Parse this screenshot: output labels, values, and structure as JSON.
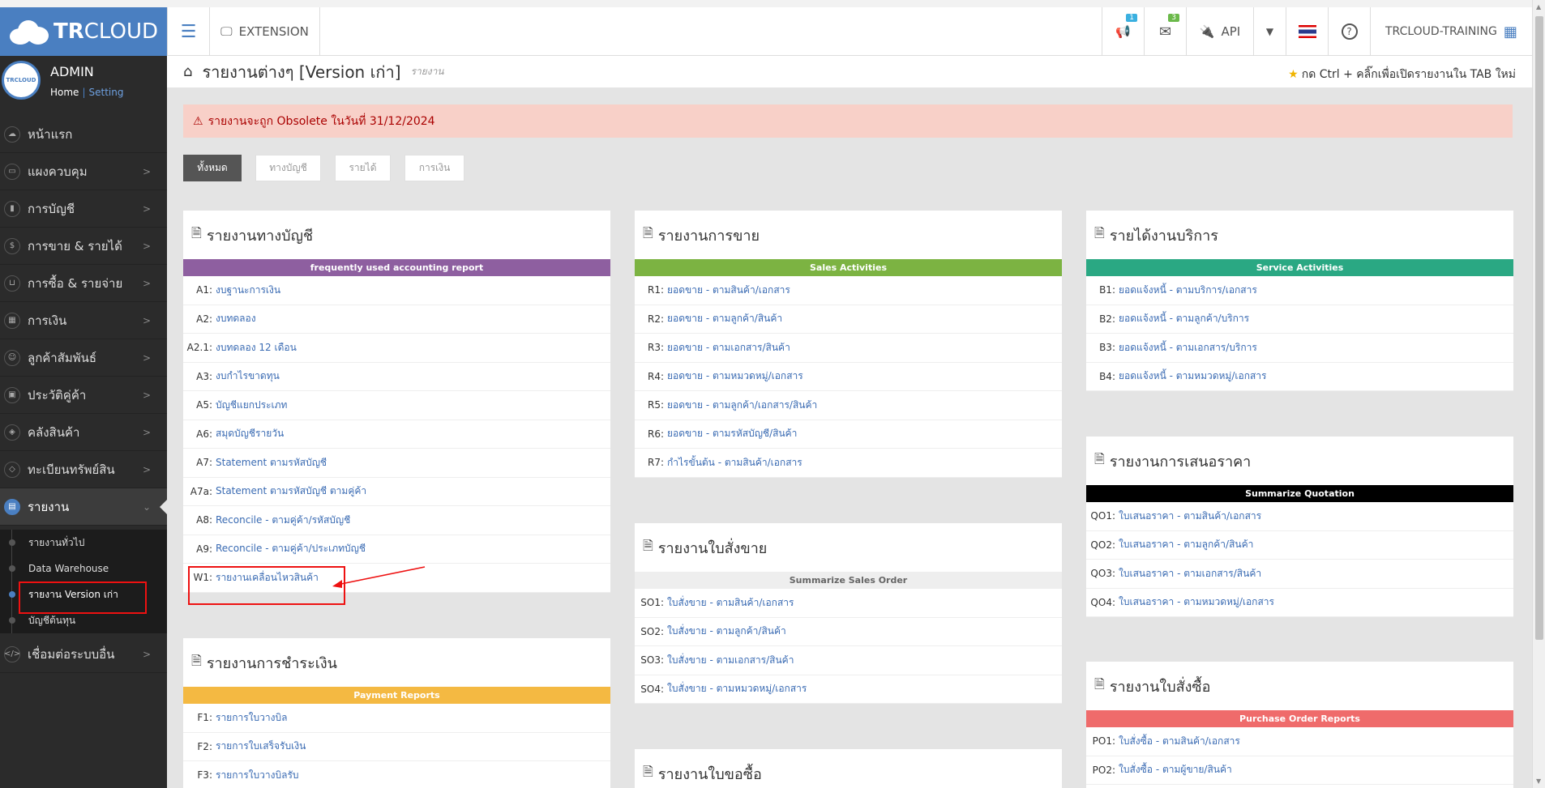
{
  "topbar": {
    "brand_bold": "TR",
    "brand_light": "CLOUD",
    "extension_label": "EXTENSION",
    "notif_count": "1",
    "mail_count": "3",
    "api_label": "API",
    "company": "TRCLOUD-TRAINING"
  },
  "user": {
    "name": "ADMIN",
    "home": "Home",
    "sep": "|",
    "setting": "Setting",
    "avatar_text": "TRCLOUD"
  },
  "sidebar": {
    "items": [
      {
        "label": "หน้าแรก",
        "icon": "cloud-icon"
      },
      {
        "label": "แผงควบคุม",
        "icon": "monitor-icon"
      },
      {
        "label": "การบัญชี",
        "icon": "book-icon"
      },
      {
        "label": "การขาย & รายได้",
        "icon": "dollar-icon"
      },
      {
        "label": "การซื้อ & รายจ่าย",
        "icon": "cart-icon"
      },
      {
        "label": "การเงิน",
        "icon": "calendar-icon"
      },
      {
        "label": "ลูกค้าสัมพันธ์",
        "icon": "users-icon"
      },
      {
        "label": "ประวัติคู่ค้า",
        "icon": "contact-icon"
      },
      {
        "label": "คลังสินค้า",
        "icon": "cubes-icon"
      },
      {
        "label": "ทะเบียนทรัพย์สิน",
        "icon": "diamond-icon"
      },
      {
        "label": "รายงาน",
        "icon": "report-icon"
      }
    ],
    "subs": [
      "รายงานทั่วไป",
      "Data Warehouse",
      "รายงาน Version เก่า",
      "บัญชีต้นทุน"
    ],
    "last": {
      "label": "เชื่อมต่อระบบอื่น",
      "icon": "code-icon"
    }
  },
  "breadcrumb": {
    "title": "รายงานต่างๆ [Version เก่า]",
    "subtitle": "รายงาน",
    "hint": "กด Ctrl + คลิ๊กเพื่อเปิดรายงานใน TAB ใหม่"
  },
  "alert": "รายงานจะถูก Obsolete ในวันที่ 31/12/2024",
  "filters": [
    "ทั้งหมด",
    "ทางบัญชี",
    "รายได้",
    "การเงิน"
  ],
  "panels": {
    "acc": {
      "title": "รายงานทางบัญชี",
      "band": "frequently used accounting report",
      "band_color": "#8e5fa0",
      "rows": [
        {
          "code": "A1:",
          "label": "งบฐานะการเงิน"
        },
        {
          "code": "A2:",
          "label": "งบทดลอง"
        },
        {
          "code": "A2.1:",
          "label": "งบทดลอง 12 เดือน"
        },
        {
          "code": "A3:",
          "label": "งบกำไรขาดทุน"
        },
        {
          "code": "A5:",
          "label": "บัญชีแยกประเภท"
        },
        {
          "code": "A6:",
          "label": "สมุดบัญชีรายวัน"
        },
        {
          "code": "A7:",
          "label": "Statement ตามรหัสบัญชี"
        },
        {
          "code": "A7a:",
          "label": "Statement ตามรหัสบัญชี ตามคู่ค้า"
        },
        {
          "code": "A8:",
          "label": "Reconcile - ตามคู่ค้า/รหัสบัญชี"
        },
        {
          "code": "A9:",
          "label": "Reconcile - ตามคู่ค้า/ประเภทบัญชี"
        },
        {
          "code": "W1:",
          "label": "รายงานเคลื่อนไหวสินค้า"
        }
      ]
    },
    "sales": {
      "title": "รายงานการขาย",
      "band": "Sales Activities",
      "band_color": "#7cb342",
      "rows": [
        {
          "code": "R1:",
          "label": "ยอดขาย - ตามสินค้า/เอกสาร"
        },
        {
          "code": "R2:",
          "label": "ยอดขาย - ตามลูกค้า/สินค้า"
        },
        {
          "code": "R3:",
          "label": "ยอดขาย - ตามเอกสาร/สินค้า"
        },
        {
          "code": "R4:",
          "label": "ยอดขาย - ตามหมวดหมู่/เอกสาร"
        },
        {
          "code": "R5:",
          "label": "ยอดขาย - ตามลูกค้า/เอกสาร/สินค้า"
        },
        {
          "code": "R6:",
          "label": "ยอดขาย - ตามรหัสบัญชี/สินค้า"
        },
        {
          "code": "R7:",
          "label": "กำไรขั้นต้น - ตามสินค้า/เอกสาร"
        }
      ]
    },
    "service": {
      "title": "รายได้งานบริการ",
      "band": "Service Activities",
      "band_color": "#2aa883",
      "rows": [
        {
          "code": "B1:",
          "label": "ยอดแจ้งหนี้ - ตามบริการ/เอกสาร"
        },
        {
          "code": "B2:",
          "label": "ยอดแจ้งหนี้ - ตามลูกค้า/บริการ"
        },
        {
          "code": "B3:",
          "label": "ยอดแจ้งหนี้ - ตามเอกสาร/บริการ"
        },
        {
          "code": "B4:",
          "label": "ยอดแจ้งหนี้ - ตามหมวดหมู่/เอกสาร"
        }
      ]
    },
    "quote": {
      "title": "รายงานการเสนอราคา",
      "band": "Summarize Quotation",
      "band_color": "#000000",
      "rows": [
        {
          "code": "QO1:",
          "label": "ใบเสนอราคา - ตามสินค้า/เอกสาร"
        },
        {
          "code": "QO2:",
          "label": "ใบเสนอราคา - ตามลูกค้า/สินค้า"
        },
        {
          "code": "QO3:",
          "label": "ใบเสนอราคา - ตามเอกสาร/สินค้า"
        },
        {
          "code": "QO4:",
          "label": "ใบเสนอราคา - ตามหมวดหมู่/เอกสาร"
        }
      ]
    },
    "so": {
      "title": "รายงานใบสั่งขาย",
      "band": "Summarize Sales Order",
      "band_color": "#eeeeee",
      "band_text": "#666666",
      "rows": [
        {
          "code": "SO1:",
          "label": "ใบสั่งขาย - ตามสินค้า/เอกสาร"
        },
        {
          "code": "SO2:",
          "label": "ใบสั่งขาย - ตามลูกค้า/สินค้า"
        },
        {
          "code": "SO3:",
          "label": "ใบสั่งขาย - ตามเอกสาร/สินค้า"
        },
        {
          "code": "SO4:",
          "label": "ใบสั่งขาย - ตามหมวดหมู่/เอกสาร"
        }
      ]
    },
    "pay": {
      "title": "รายงานการชำระเงิน",
      "band": "Payment Reports",
      "band_color": "#f4b942",
      "rows": [
        {
          "code": "F1:",
          "label": "รายการใบวางบิล"
        },
        {
          "code": "F2:",
          "label": "รายการใบเสร็จรับเงิน"
        },
        {
          "code": "F3:",
          "label": "รายการใบวางบิลรับ"
        }
      ]
    },
    "po": {
      "title": "รายงานใบสั่งซื้อ",
      "band": "Purchase Order Reports",
      "band_color": "#ef6b6b",
      "rows": [
        {
          "code": "PO1:",
          "label": "ใบสั่งซื้อ - ตามสินค้า/เอกสาร"
        },
        {
          "code": "PO2:",
          "label": "ใบสั่งซื้อ - ตามผู้ขาย/สินค้า"
        }
      ]
    },
    "pr": {
      "title": "รายงานใบขอซื้อ"
    }
  }
}
